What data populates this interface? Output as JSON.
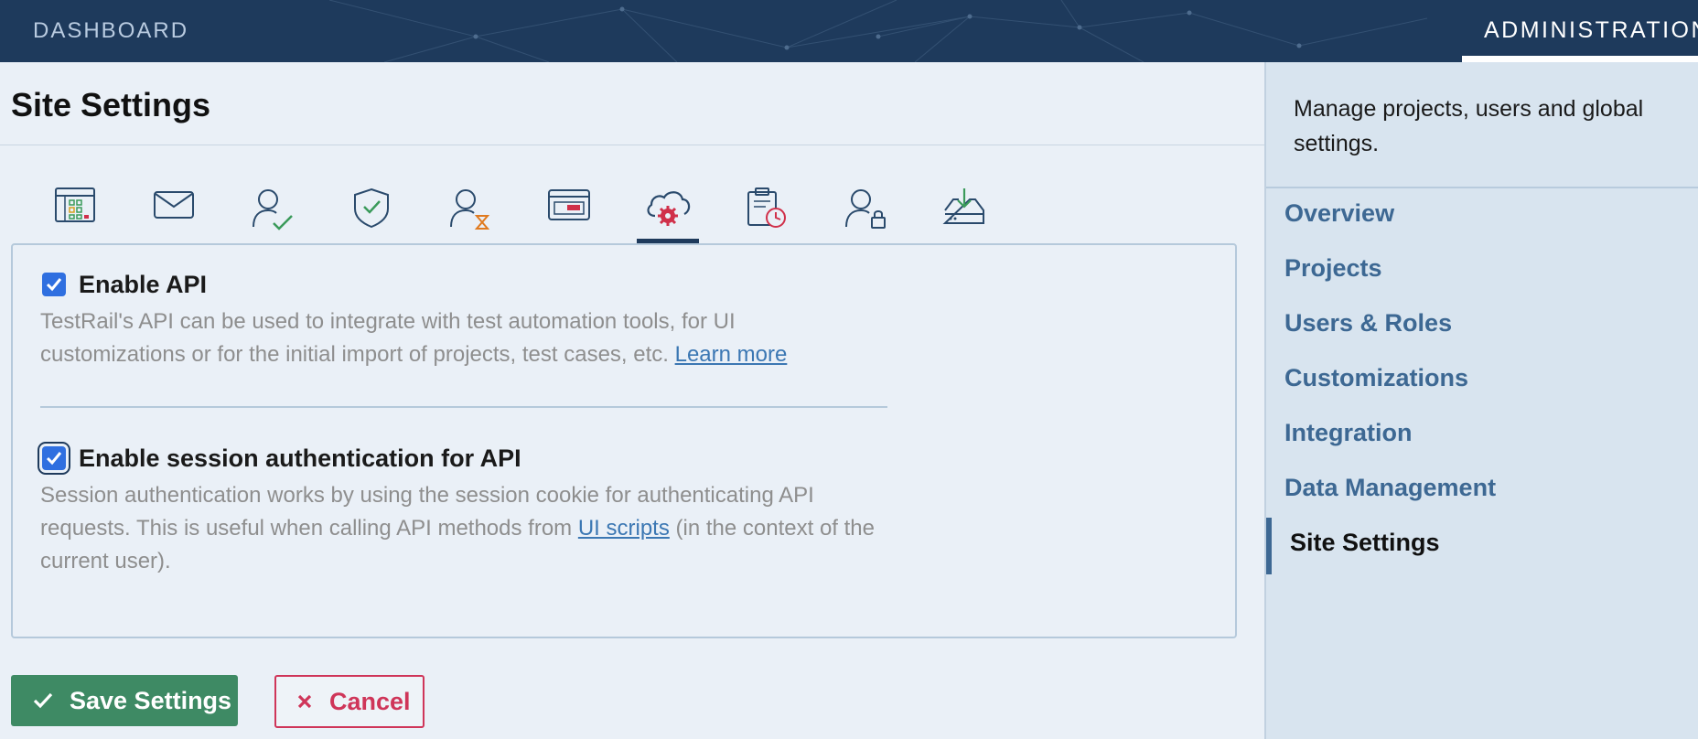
{
  "topbar": {
    "dashboard_label": "DASHBOARD",
    "administration_label": "ADMINISTRATION"
  },
  "page": {
    "title": "Site Settings"
  },
  "tabs": [
    {
      "icon": "overview-grid-icon"
    },
    {
      "icon": "email-icon"
    },
    {
      "icon": "user-check-icon"
    },
    {
      "icon": "shield-check-icon"
    },
    {
      "icon": "user-hourglass-icon"
    },
    {
      "icon": "browser-window-icon"
    },
    {
      "icon": "cloud-gear-icon",
      "active": true
    },
    {
      "icon": "clipboard-clock-icon"
    },
    {
      "icon": "user-lock-icon"
    },
    {
      "icon": "inbox-download-icon"
    }
  ],
  "options": {
    "enable_api": {
      "label": "Enable API",
      "checked": true,
      "desc_text": "TestRail's API can be used to integrate with test automation tools, for UI customizations or for the initial import of projects, test cases, etc. ",
      "link_text": "Learn more"
    },
    "session_auth": {
      "label": "Enable session authentication for API",
      "checked": true,
      "desc_before": "Session authentication works by using the session cookie for authenticating API requests. This is useful when calling API methods from ",
      "link_text": "UI scripts",
      "desc_after": " (in the context of the current user)."
    }
  },
  "buttons": {
    "save_label": "Save Settings",
    "cancel_label": "Cancel"
  },
  "sidebar": {
    "description": "Manage projects, users and global settings.",
    "items": [
      {
        "label": "Overview"
      },
      {
        "label": "Projects"
      },
      {
        "label": "Users & Roles"
      },
      {
        "label": "Customizations"
      },
      {
        "label": "Integration"
      },
      {
        "label": "Data Management"
      },
      {
        "label": "Site Settings",
        "active": true
      }
    ]
  },
  "colors": {
    "topbar": "#1e3a5c",
    "accent_link": "#3d6893",
    "save_green": "#3e8a64",
    "cancel_red": "#cf3559",
    "checkbox_blue": "#2f6fe0"
  }
}
